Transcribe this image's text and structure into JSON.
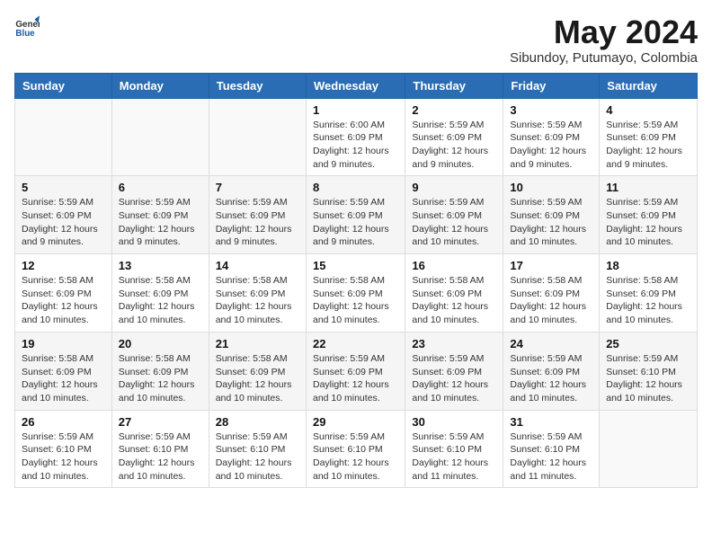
{
  "logo": {
    "general": "General",
    "blue": "Blue"
  },
  "header": {
    "month_year": "May 2024",
    "location": "Sibundoy, Putumayo, Colombia"
  },
  "weekdays": [
    "Sunday",
    "Monday",
    "Tuesday",
    "Wednesday",
    "Thursday",
    "Friday",
    "Saturday"
  ],
  "weeks": [
    [
      {
        "day": "",
        "info": ""
      },
      {
        "day": "",
        "info": ""
      },
      {
        "day": "",
        "info": ""
      },
      {
        "day": "1",
        "info": "Sunrise: 6:00 AM\nSunset: 6:09 PM\nDaylight: 12 hours\nand 9 minutes."
      },
      {
        "day": "2",
        "info": "Sunrise: 5:59 AM\nSunset: 6:09 PM\nDaylight: 12 hours\nand 9 minutes."
      },
      {
        "day": "3",
        "info": "Sunrise: 5:59 AM\nSunset: 6:09 PM\nDaylight: 12 hours\nand 9 minutes."
      },
      {
        "day": "4",
        "info": "Sunrise: 5:59 AM\nSunset: 6:09 PM\nDaylight: 12 hours\nand 9 minutes."
      }
    ],
    [
      {
        "day": "5",
        "info": "Sunrise: 5:59 AM\nSunset: 6:09 PM\nDaylight: 12 hours\nand 9 minutes."
      },
      {
        "day": "6",
        "info": "Sunrise: 5:59 AM\nSunset: 6:09 PM\nDaylight: 12 hours\nand 9 minutes."
      },
      {
        "day": "7",
        "info": "Sunrise: 5:59 AM\nSunset: 6:09 PM\nDaylight: 12 hours\nand 9 minutes."
      },
      {
        "day": "8",
        "info": "Sunrise: 5:59 AM\nSunset: 6:09 PM\nDaylight: 12 hours\nand 9 minutes."
      },
      {
        "day": "9",
        "info": "Sunrise: 5:59 AM\nSunset: 6:09 PM\nDaylight: 12 hours\nand 10 minutes."
      },
      {
        "day": "10",
        "info": "Sunrise: 5:59 AM\nSunset: 6:09 PM\nDaylight: 12 hours\nand 10 minutes."
      },
      {
        "day": "11",
        "info": "Sunrise: 5:59 AM\nSunset: 6:09 PM\nDaylight: 12 hours\nand 10 minutes."
      }
    ],
    [
      {
        "day": "12",
        "info": "Sunrise: 5:58 AM\nSunset: 6:09 PM\nDaylight: 12 hours\nand 10 minutes."
      },
      {
        "day": "13",
        "info": "Sunrise: 5:58 AM\nSunset: 6:09 PM\nDaylight: 12 hours\nand 10 minutes."
      },
      {
        "day": "14",
        "info": "Sunrise: 5:58 AM\nSunset: 6:09 PM\nDaylight: 12 hours\nand 10 minutes."
      },
      {
        "day": "15",
        "info": "Sunrise: 5:58 AM\nSunset: 6:09 PM\nDaylight: 12 hours\nand 10 minutes."
      },
      {
        "day": "16",
        "info": "Sunrise: 5:58 AM\nSunset: 6:09 PM\nDaylight: 12 hours\nand 10 minutes."
      },
      {
        "day": "17",
        "info": "Sunrise: 5:58 AM\nSunset: 6:09 PM\nDaylight: 12 hours\nand 10 minutes."
      },
      {
        "day": "18",
        "info": "Sunrise: 5:58 AM\nSunset: 6:09 PM\nDaylight: 12 hours\nand 10 minutes."
      }
    ],
    [
      {
        "day": "19",
        "info": "Sunrise: 5:58 AM\nSunset: 6:09 PM\nDaylight: 12 hours\nand 10 minutes."
      },
      {
        "day": "20",
        "info": "Sunrise: 5:58 AM\nSunset: 6:09 PM\nDaylight: 12 hours\nand 10 minutes."
      },
      {
        "day": "21",
        "info": "Sunrise: 5:58 AM\nSunset: 6:09 PM\nDaylight: 12 hours\nand 10 minutes."
      },
      {
        "day": "22",
        "info": "Sunrise: 5:59 AM\nSunset: 6:09 PM\nDaylight: 12 hours\nand 10 minutes."
      },
      {
        "day": "23",
        "info": "Sunrise: 5:59 AM\nSunset: 6:09 PM\nDaylight: 12 hours\nand 10 minutes."
      },
      {
        "day": "24",
        "info": "Sunrise: 5:59 AM\nSunset: 6:09 PM\nDaylight: 12 hours\nand 10 minutes."
      },
      {
        "day": "25",
        "info": "Sunrise: 5:59 AM\nSunset: 6:10 PM\nDaylight: 12 hours\nand 10 minutes."
      }
    ],
    [
      {
        "day": "26",
        "info": "Sunrise: 5:59 AM\nSunset: 6:10 PM\nDaylight: 12 hours\nand 10 minutes."
      },
      {
        "day": "27",
        "info": "Sunrise: 5:59 AM\nSunset: 6:10 PM\nDaylight: 12 hours\nand 10 minutes."
      },
      {
        "day": "28",
        "info": "Sunrise: 5:59 AM\nSunset: 6:10 PM\nDaylight: 12 hours\nand 10 minutes."
      },
      {
        "day": "29",
        "info": "Sunrise: 5:59 AM\nSunset: 6:10 PM\nDaylight: 12 hours\nand 10 minutes."
      },
      {
        "day": "30",
        "info": "Sunrise: 5:59 AM\nSunset: 6:10 PM\nDaylight: 12 hours\nand 11 minutes."
      },
      {
        "day": "31",
        "info": "Sunrise: 5:59 AM\nSunset: 6:10 PM\nDaylight: 12 hours\nand 11 minutes."
      },
      {
        "day": "",
        "info": ""
      }
    ]
  ]
}
